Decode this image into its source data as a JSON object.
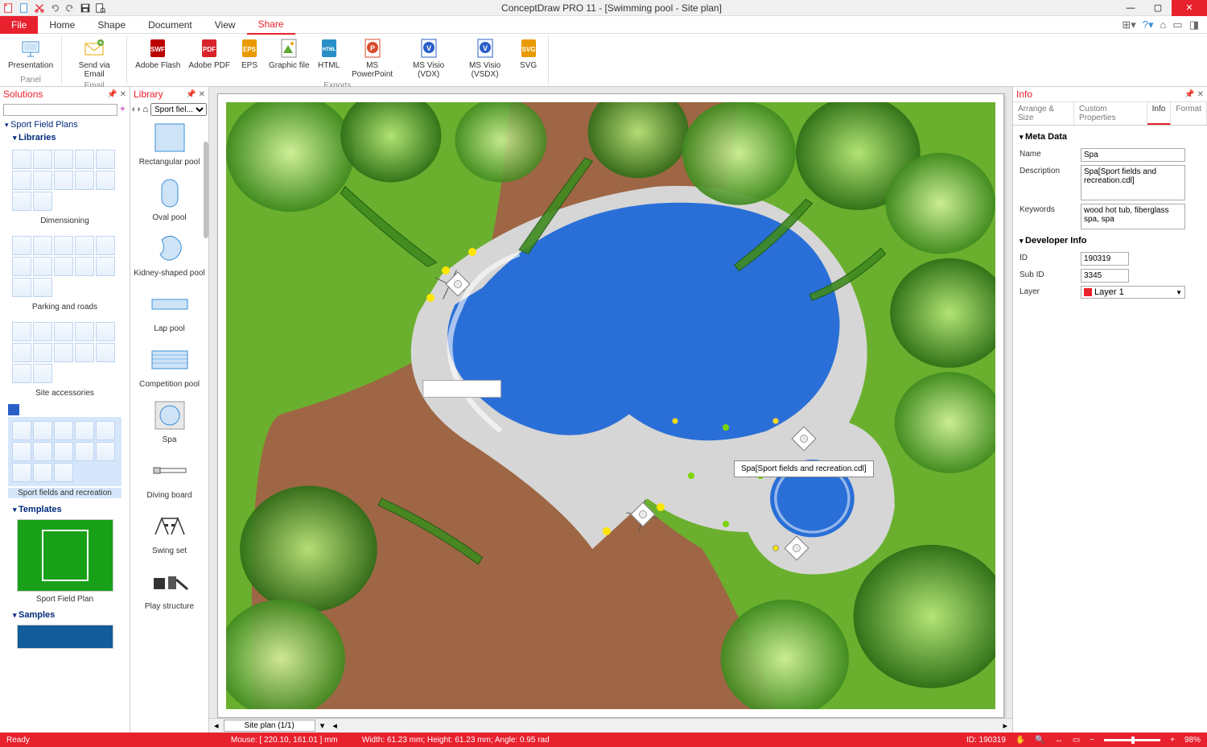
{
  "titlebar": {
    "title": "ConceptDraw PRO 11 - [Swimming pool - Site plan]"
  },
  "menu": {
    "file": "File",
    "tabs": [
      "Home",
      "Shape",
      "Document",
      "View",
      "Share"
    ],
    "active": "Share"
  },
  "ribbon": {
    "groups": [
      {
        "label": "Panel",
        "items": [
          "Presentation"
        ]
      },
      {
        "label": "Email",
        "items": [
          "Send via Email"
        ]
      },
      {
        "label": "Exports",
        "items": [
          "Adobe Flash",
          "Adobe PDF",
          "EPS",
          "Graphic file",
          "HTML",
          "MS PowerPoint",
          "MS Visio (VDX)",
          "MS Visio (VSDX)",
          "SVG"
        ]
      }
    ]
  },
  "solutions": {
    "title": "Solutions",
    "search_placeholder": "",
    "root": "Sport Field Plans",
    "libraries_label": "Libraries",
    "libs": [
      {
        "name": "Dimensioning",
        "cells": 12
      },
      {
        "name": "Parking and roads",
        "cells": 12
      },
      {
        "name": "Site accessories",
        "cells": 12
      },
      {
        "name": "Sport fields and recreation",
        "cells": 13,
        "selected": true
      }
    ],
    "templates_label": "Templates",
    "template_name": "Sport Field Plan",
    "samples_label": "Samples"
  },
  "library": {
    "title": "Library",
    "dropdown": "Sport fiel...",
    "shapes": [
      "Rectangular pool",
      "Oval pool",
      "Kidney-shaped pool",
      "Lap pool",
      "Competition pool",
      "Spa",
      "Diving board",
      "Swing set",
      "Play structure"
    ]
  },
  "canvas": {
    "page_tab": "Site plan (1/1)",
    "tooltip": "Spa[Sport fields and recreation.cdl]"
  },
  "info": {
    "title": "Info",
    "tabs": [
      "Arrange & Size",
      "Custom Properties",
      "Info",
      "Format"
    ],
    "active": "Info",
    "meta_section": "Meta Data",
    "name_label": "Name",
    "name_value": "Spa",
    "desc_label": "Description",
    "desc_value": "Spa[Sport fields and recreation.cdl]",
    "keywords_label": "Keywords",
    "keywords_value": "wood hot tub, fiberglass spa, spa",
    "dev_section": "Developer Info",
    "id_label": "ID",
    "id_value": "190319",
    "subid_label": "Sub ID",
    "subid_value": "3345",
    "layer_label": "Layer",
    "layer_value": "Layer 1"
  },
  "status": {
    "ready": "Ready",
    "mouse": "Mouse: [ 220.10, 161.01 ] mm",
    "dims": "Width: 61.23 mm;   Height: 61.23 mm;   Angle: 0.95 rad",
    "id": "ID: 190319",
    "zoom": "98%"
  }
}
